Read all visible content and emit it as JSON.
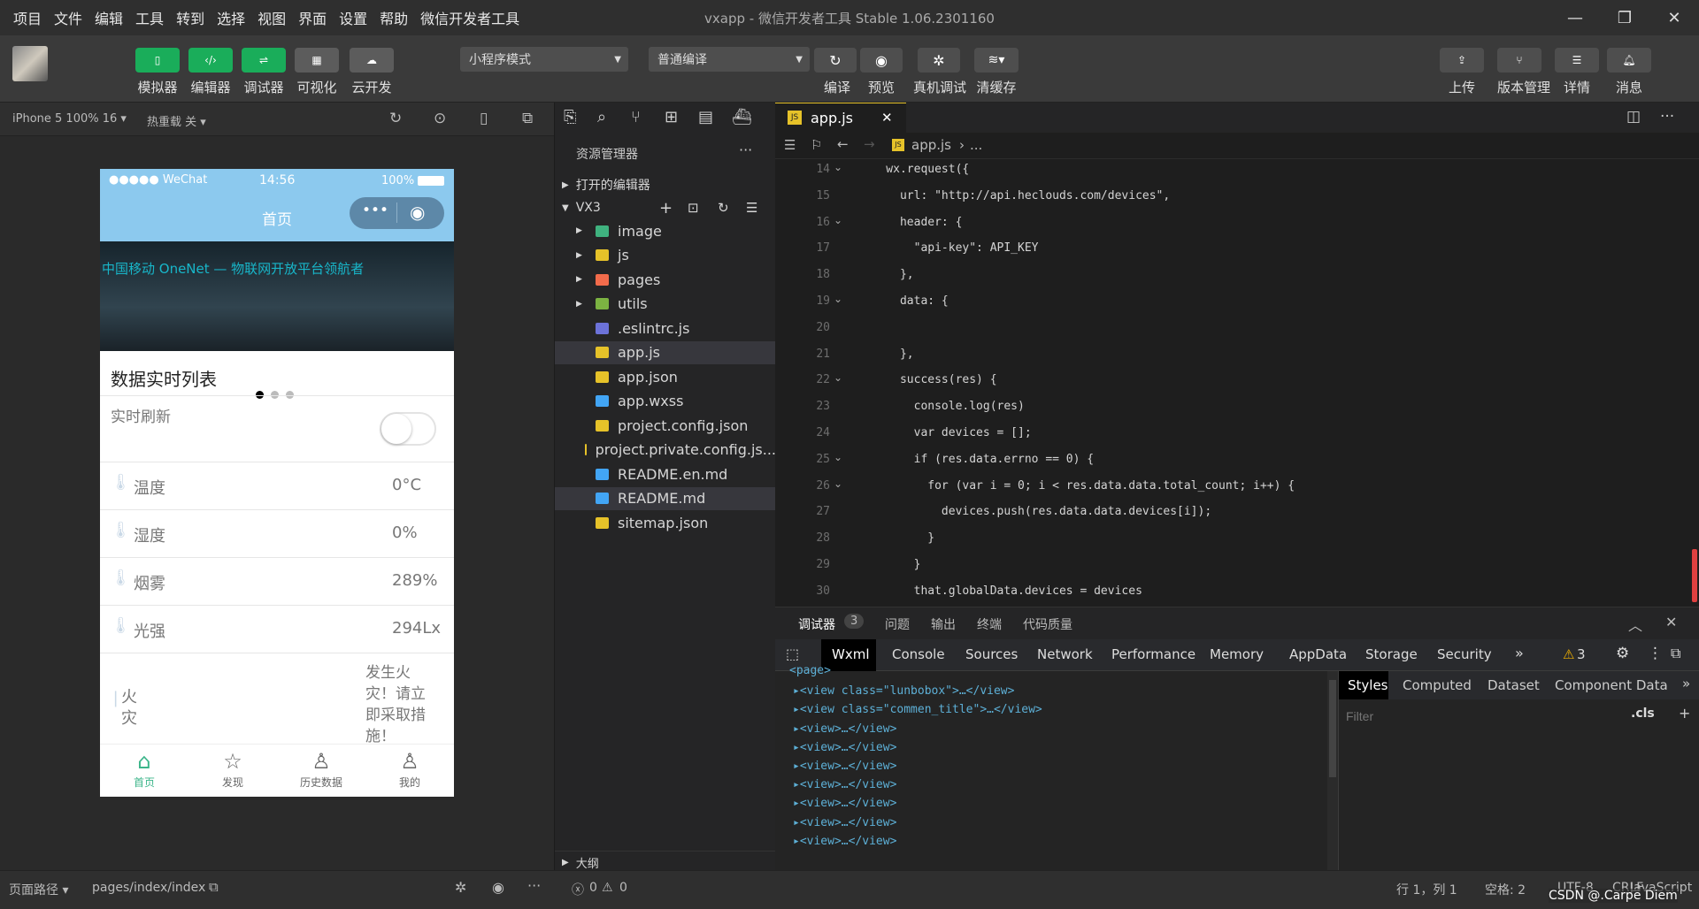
{
  "menu": [
    "项目",
    "文件",
    "编辑",
    "工具",
    "转到",
    "选择",
    "视图",
    "界面",
    "设置",
    "帮助",
    "微信开发者工具"
  ],
  "window_title": "vxapp - 微信开发者工具 Stable 1.06.2301160",
  "toolbar": {
    "left_labels": [
      "模拟器",
      "编辑器",
      "调试器",
      "可视化",
      "云开发"
    ],
    "mode_select": "小程序模式",
    "compile_select": "普通编译",
    "mid_labels": [
      "编译",
      "预览",
      "真机调试",
      "清缓存"
    ],
    "right_labels": [
      "上传",
      "版本管理",
      "详情",
      "消息"
    ]
  },
  "sim_header": {
    "device": "iPhone 5 100% 16",
    "hot_reload": "热重载 关"
  },
  "phone": {
    "carrier": "●●●●● WeChat",
    "time": "14:56",
    "battery": "100%",
    "nav_title": "首页",
    "banner_text": "中国移动 OneNet — 物联网开放平台领航者",
    "section_title": "数据实时列表",
    "realtime_label": "实时刷新",
    "rows": [
      {
        "label": "温度",
        "value": "0°C"
      },
      {
        "label": "湿度",
        "value": "0%"
      },
      {
        "label": "烟雾",
        "value": "289%"
      },
      {
        "label": "光强",
        "value": "294Lx"
      }
    ],
    "fire_label": "火灾",
    "fire_value": "发生火灾！请立即采取措施！",
    "tabs": [
      "首页",
      "发现",
      "历史数据",
      "我的"
    ]
  },
  "explorer": {
    "title": "资源管理器",
    "open_editors": "打开的编辑器",
    "project": "VX3",
    "items": [
      {
        "name": "image",
        "kind": "folder",
        "color": "#3fb27f"
      },
      {
        "name": "js",
        "kind": "folder",
        "color": "#e6c229"
      },
      {
        "name": "pages",
        "kind": "folder",
        "color": "#f26b4b"
      },
      {
        "name": "utils",
        "kind": "folder",
        "color": "#7cb342"
      },
      {
        "name": ".eslintrc.js",
        "kind": "file",
        "color": "#6c72d8"
      },
      {
        "name": "app.js",
        "kind": "file",
        "color": "#e6c229"
      },
      {
        "name": "app.json",
        "kind": "file",
        "color": "#e6c229"
      },
      {
        "name": "app.wxss",
        "kind": "file",
        "color": "#42a5f5"
      },
      {
        "name": "project.config.json",
        "kind": "file",
        "color": "#e6c229"
      },
      {
        "name": "project.private.config.js...",
        "kind": "file",
        "color": "#e6c229"
      },
      {
        "name": "README.en.md",
        "kind": "file",
        "color": "#42a5f5"
      },
      {
        "name": "README.md",
        "kind": "file",
        "color": "#42a5f5"
      },
      {
        "name": "sitemap.json",
        "kind": "file",
        "color": "#e6c229"
      }
    ],
    "outline": "大纲",
    "errors": "0",
    "warnings": "0"
  },
  "editor": {
    "tab": "app.js",
    "crumb_file": "app.js",
    "crumb_rest": "...",
    "lines": [
      {
        "n": "14",
        "code": "    wx.request({"
      },
      {
        "n": "15",
        "code": "      url: \"http://api.heclouds.com/devices\","
      },
      {
        "n": "16",
        "code": "      header: {"
      },
      {
        "n": "17",
        "code": "        \"api-key\": API_KEY"
      },
      {
        "n": "18",
        "code": "      },"
      },
      {
        "n": "19",
        "code": "      data: {"
      },
      {
        "n": "20",
        "code": ""
      },
      {
        "n": "21",
        "code": "      },"
      },
      {
        "n": "22",
        "code": "      success(res) {"
      },
      {
        "n": "23",
        "code": "        console.log(res)"
      },
      {
        "n": "24",
        "code": "        var devices = [];"
      },
      {
        "n": "25",
        "code": "        if (res.data.errno == 0) {"
      },
      {
        "n": "26",
        "code": "          for (var i = 0; i < res.data.data.total_count; i++) {"
      },
      {
        "n": "27",
        "code": "            devices.push(res.data.data.devices[i]);"
      },
      {
        "n": "28",
        "code": "          }"
      },
      {
        "n": "29",
        "code": "        }"
      },
      {
        "n": "30",
        "code": "        that.globalData.devices = devices"
      }
    ]
  },
  "debug": {
    "tabs": [
      "调试器",
      "问题",
      "输出",
      "终端",
      "代码质量"
    ],
    "badge": "3",
    "devtools_tabs": [
      "Wxml",
      "Console",
      "Sources",
      "Network",
      "Performance",
      "Memory",
      "AppData",
      "Storage",
      "Security"
    ],
    "warn_count": "3",
    "wxml": [
      "<page>",
      "▸<view class=\"lunbobox\">…</view>",
      "▸<view class=\"commen_title\">…</view>",
      "▸<view>…</view>",
      "▸<view>…</view>",
      "▸<view>…</view>",
      "▸<view>…</view>",
      "▸<view>…</view>",
      "▸<view>…</view>",
      "▸<view>…</view>"
    ],
    "style_tabs": [
      "Styles",
      "Computed",
      "Dataset",
      "Component Data"
    ],
    "filter_placeholder": "Filter",
    "cls": ".cls"
  },
  "bottom": {
    "path_label": "页面路径",
    "path": "pages/index/index",
    "position": "行 1，列 1",
    "spaces": "空格: 2",
    "encoding": "UTF-8",
    "eol": "CRLF",
    "lang": "JavaScript",
    "watermark": "CSDN @.Carpe Diem"
  }
}
